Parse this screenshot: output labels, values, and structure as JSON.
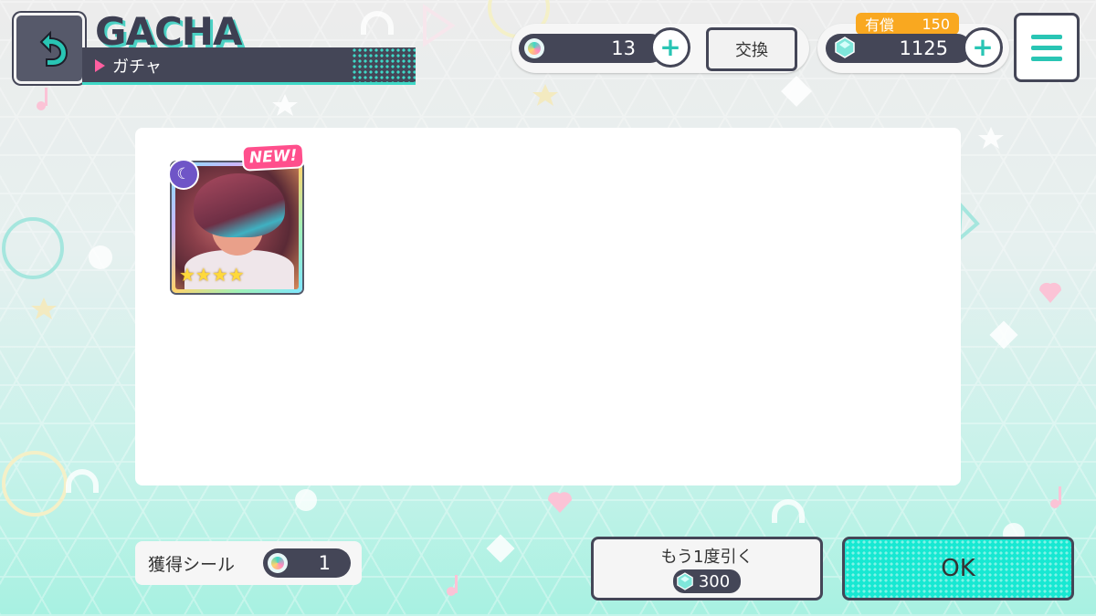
{
  "header": {
    "title": "GACHA",
    "subtitle": "ガチャ",
    "back_icon": "back-arrow-icon",
    "menu_icon": "hamburger-menu-icon"
  },
  "currencies": {
    "tickets": {
      "icon": "disc-ticket-icon",
      "value": "13"
    },
    "exchange_label": "交換",
    "gems": {
      "icon": "crystal-gem-icon",
      "value": "1125"
    },
    "paid_label": "有償",
    "paid_value": "150"
  },
  "result": {
    "cards": [
      {
        "badge": "NEW!",
        "attribute_icon": "moon-icon",
        "stars": 4,
        "star_glyphs": "★★★★"
      }
    ]
  },
  "footer": {
    "stickers_label": "獲得シール",
    "stickers_value": "1",
    "again_label": "もう1度引く",
    "again_cost": "300",
    "ok_label": "OK"
  },
  "colors": {
    "accent": "#3ed8c6",
    "dark": "#444657",
    "pink": "#ff4f8c",
    "ok_button": "#17e8d2",
    "paid_badge": "#f9a820"
  }
}
